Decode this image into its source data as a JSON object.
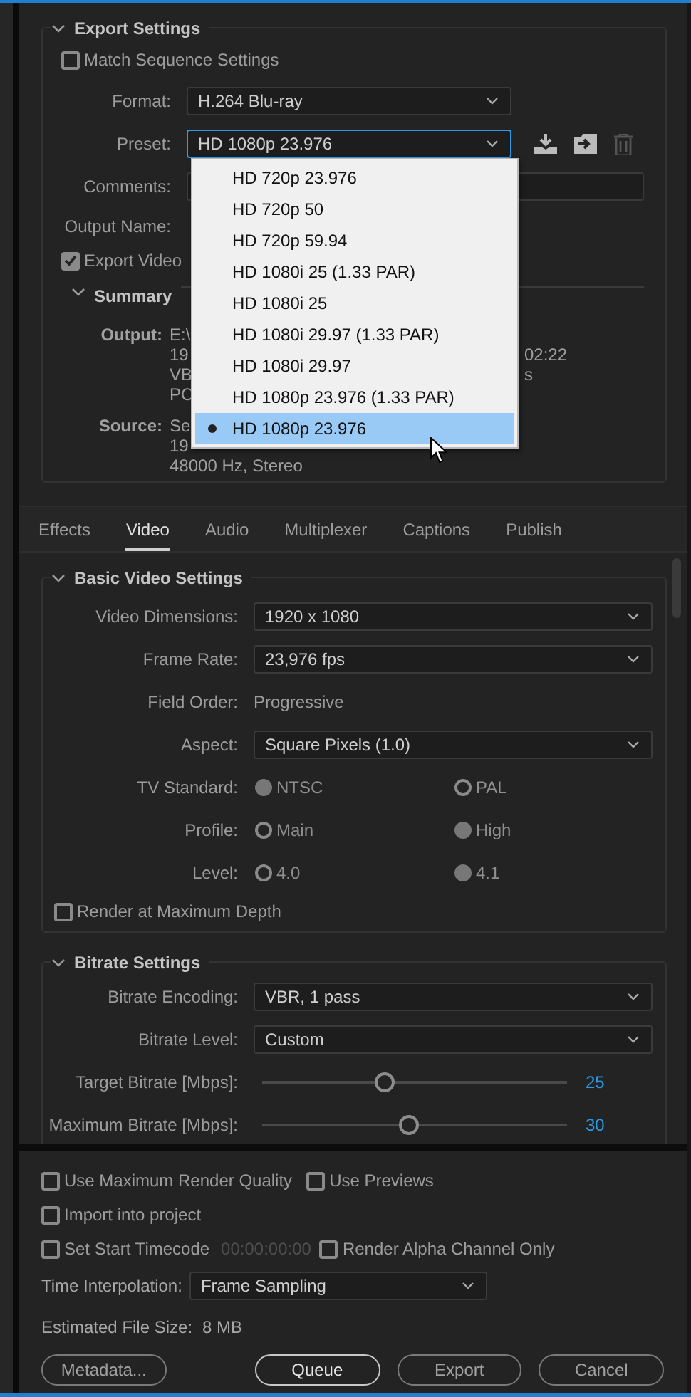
{
  "export_settings": {
    "title": "Export Settings",
    "expanded": true,
    "match_sequence": {
      "label": "Match Sequence Settings",
      "checked": false
    },
    "format": {
      "label": "Format:",
      "value": "H.264 Blu-ray"
    },
    "preset": {
      "label": "Preset:",
      "value": "HD 1080p 23.976",
      "focused": true
    },
    "comments": {
      "label": "Comments:"
    },
    "output_name": {
      "label": "Output Name:"
    },
    "export_video": {
      "label": "Export Video",
      "checked": true
    },
    "summary": {
      "title": "Summary",
      "expanded": true,
      "groups": [
        {
          "label": "Output:",
          "lines": [
            {
              "text": "E:\\"
            },
            {
              "text": "19",
              "tail": "02:22"
            },
            {
              "text": "VB",
              "tail": "s"
            },
            {
              "text": "PC"
            }
          ]
        },
        {
          "label": "Source:",
          "lines": [
            {
              "text": "Se"
            },
            {
              "text": "19"
            },
            {
              "text": "48000 Hz, Stereo"
            }
          ]
        }
      ]
    }
  },
  "preset_menu": {
    "items": [
      {
        "label": "HD 720p 23.976",
        "selected": false
      },
      {
        "label": "HD 720p 50",
        "selected": false
      },
      {
        "label": "HD 720p 59.94",
        "selected": false
      },
      {
        "label": "HD 1080i 25 (1.33 PAR)",
        "selected": false
      },
      {
        "label": "HD 1080i 25",
        "selected": false
      },
      {
        "label": "HD 1080i 29.97 (1.33 PAR)",
        "selected": false
      },
      {
        "label": "HD 1080i 29.97",
        "selected": false
      },
      {
        "label": "HD 1080p 23.976 (1.33 PAR)",
        "selected": false
      },
      {
        "label": "HD 1080p 23.976",
        "selected": true
      }
    ]
  },
  "tabs": [
    {
      "label": "Effects",
      "selected": false
    },
    {
      "label": "Video",
      "selected": true
    },
    {
      "label": "Audio",
      "selected": false
    },
    {
      "label": "Multiplexer",
      "selected": false
    },
    {
      "label": "Captions",
      "selected": false
    },
    {
      "label": "Publish",
      "selected": false
    }
  ],
  "basic_video": {
    "title": "Basic Video Settings",
    "expanded": true,
    "rows": [
      {
        "kind": "select",
        "label": "Video Dimensions:",
        "value": "1920 x 1080"
      },
      {
        "kind": "select",
        "label": "Frame Rate:",
        "value": "23,976 fps"
      },
      {
        "kind": "text",
        "label": "Field Order:",
        "value": "Progressive"
      },
      {
        "kind": "select",
        "label": "Aspect:",
        "value": "Square Pixels (1.0)"
      },
      {
        "kind": "radio",
        "label": "TV Standard:",
        "options": [
          {
            "label": "NTSC",
            "selected": true
          },
          {
            "label": "PAL",
            "selected": false
          }
        ]
      },
      {
        "kind": "radio",
        "label": "Profile:",
        "options": [
          {
            "label": "Main",
            "selected": false
          },
          {
            "label": "High",
            "selected": true
          }
        ]
      },
      {
        "kind": "radio",
        "label": "Level:",
        "options": [
          {
            "label": "4.0",
            "selected": false
          },
          {
            "label": "4.1",
            "selected": true
          }
        ]
      }
    ],
    "render_max_depth": {
      "label": "Render at Maximum Depth",
      "checked": false
    }
  },
  "bitrate": {
    "title": "Bitrate Settings",
    "expanded": true,
    "rows": [
      {
        "kind": "select",
        "label": "Bitrate Encoding:",
        "value": "VBR, 1 pass"
      },
      {
        "kind": "select",
        "label": "Bitrate Level:",
        "value": "Custom"
      },
      {
        "kind": "slider",
        "label": "Target Bitrate [Mbps]:",
        "level": 0.4,
        "reading": "25"
      },
      {
        "kind": "slider",
        "label": "Maximum Bitrate [Mbps]:",
        "level": 0.48,
        "reading": "30"
      }
    ]
  },
  "bottom": {
    "options": [
      {
        "label": "Use Maximum Render Quality",
        "checked": false
      },
      {
        "label": "Use Previews",
        "checked": false
      },
      {
        "label": "Import into project",
        "checked": false
      },
      {
        "label": "Set Start Timecode",
        "checked": false,
        "timecode": "00:00:00:00"
      },
      {
        "label": "Render Alpha Channel Only",
        "checked": false
      }
    ],
    "time_interpolation": {
      "label": "Time Interpolation:",
      "value": "Frame Sampling"
    },
    "estimated_size": {
      "label": "Estimated File Size:",
      "value": "8 MB"
    },
    "buttons": [
      {
        "label": "Metadata...",
        "default": false
      },
      {
        "label": "Queue",
        "default": true
      },
      {
        "label": "Export",
        "default": false
      },
      {
        "label": "Cancel",
        "default": false
      }
    ]
  }
}
